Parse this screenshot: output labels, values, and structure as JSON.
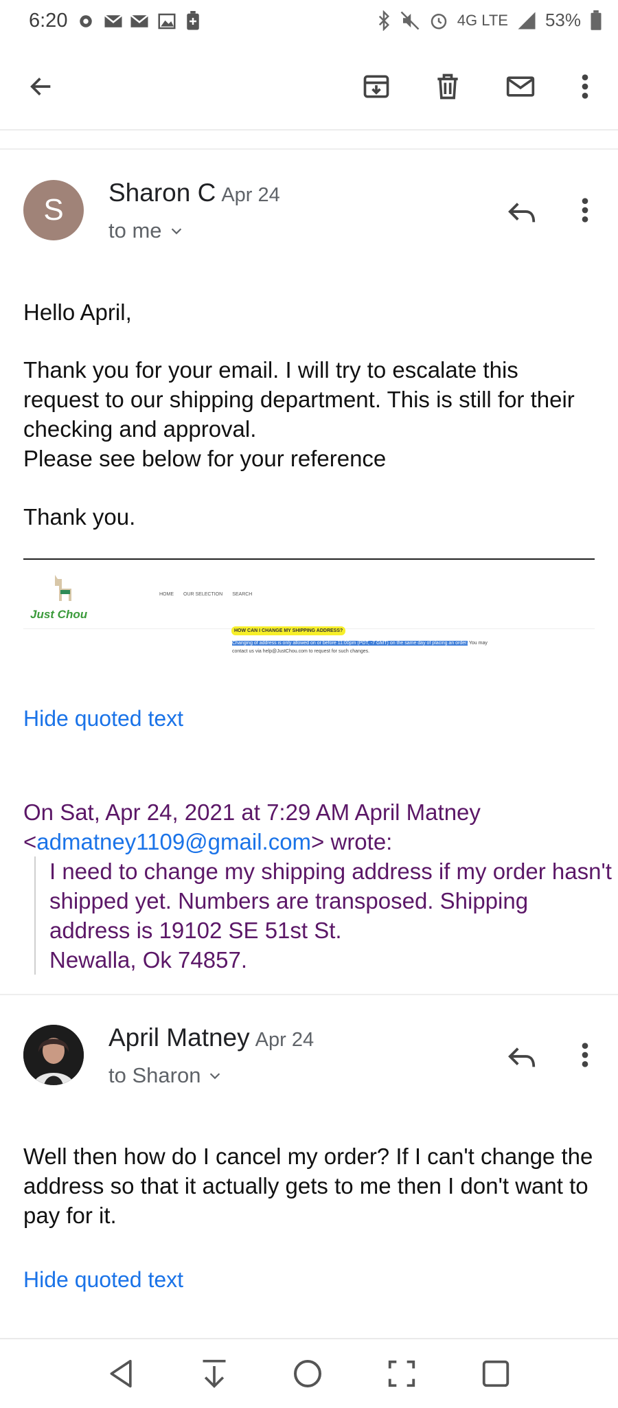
{
  "status_bar": {
    "time": "6:20",
    "network": "4G LTE",
    "battery": "53%"
  },
  "toolbar": {
    "back_icon": "arrow-left-icon",
    "archive_icon": "archive-icon",
    "delete_icon": "trash-icon",
    "mark_unread_icon": "mail-icon",
    "more_icon": "more-vert-icon"
  },
  "message1": {
    "avatar_letter": "S",
    "avatar_color": "#a08378",
    "sender": "Sharon C",
    "date": "Apr 24",
    "recipient": "to me",
    "greeting": "Hello April,",
    "paragraph": "Thank you for your email. I will try to escalate this request  to our shipping department. This is still for their checking and approval.\nPlease see below for your reference",
    "closing": "Thank you.",
    "embed": {
      "logo_text": "Just Chou",
      "nav": [
        "HOME",
        "OUR SELECTION",
        "SEARCH"
      ],
      "question": "HOW CAN I CHANGE MY SHIPPING ADDRESS?",
      "answer_highlight": "Changing of address is only allowed on or before 11:00pm (PDT, -7 GMT) on the same day of placing an order.",
      "answer_rest_1": "You may",
      "answer_rest_2": "contact us via help@JustChou.com to request for such changes."
    },
    "hide_quoted": "Hide quoted text",
    "quote_header_1": "On Sat, Apr 24, 2021 at 7:29 AM April Matney",
    "quote_email": "admatney1109@gmail.com",
    "quote_lt": "<",
    "quote_header_2": "> wrote:",
    "quote_body": "I need to change my shipping address if my order hasn't shipped yet. Numbers are transposed. Shipping address is 19102 SE 51st St.\nNewalla, Ok 74857."
  },
  "message2": {
    "sender": "April Matney",
    "date": "Apr 24",
    "recipient": "to Sharon",
    "body": "Well then how do I cancel my order? If I can't change the address so that it actually gets to me then I don't want to pay for it.",
    "hide_quoted": "Hide quoted text"
  },
  "nav_bar": [
    "back-triangle-icon",
    "down-arrow-icon",
    "home-circle-icon",
    "screenshot-frame-icon",
    "recents-square-icon"
  ]
}
